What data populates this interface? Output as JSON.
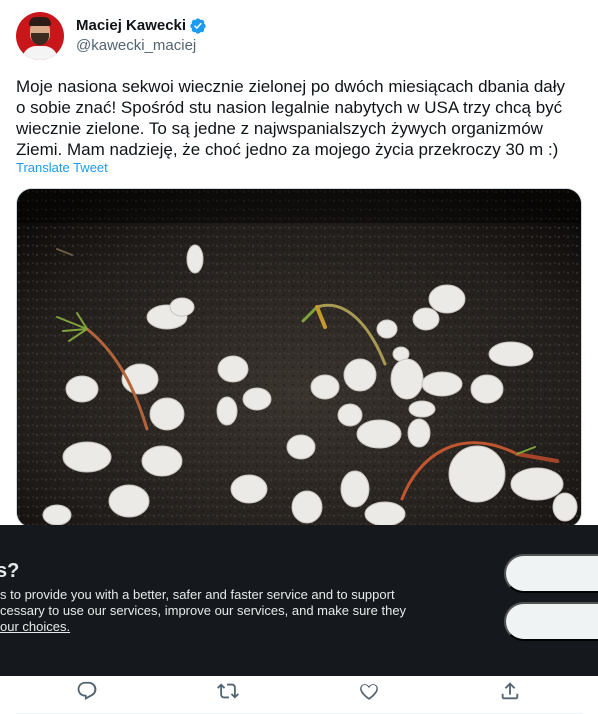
{
  "author": {
    "display_name": "Maciej Kawecki",
    "handle": "@kawecki_maciej",
    "verified": true
  },
  "tweet": {
    "text": "Moje nasiona sekwoi wiecznie zielonej po dwóch miesiącach dbania dały\no sobie znać! Spośród stu nasion legalnie nabytych w USA trzy chcą być\nwiecznie zielone. To są jedne z najwspanialszych żywych organizmów\nZiemi. Mam nadzieję, że choć jedno za mojego życia przekroczy 30 m :)",
    "translate_label": "Translate Tweet"
  },
  "cookie_banner": {
    "title": "s?",
    "body": "s to provide you with a better, safer and faster service and to support\ncessary to use our services, improve our services, and make sure they",
    "link_text": "our choices."
  },
  "actions": {
    "icons": [
      "reply-icon",
      "retweet-icon",
      "like-icon",
      "share-icon"
    ]
  },
  "colors": {
    "accent": "#1d9bf0",
    "verified": "#1d9bf0",
    "banner_bg": "#15191e",
    "icon": "#536471"
  }
}
